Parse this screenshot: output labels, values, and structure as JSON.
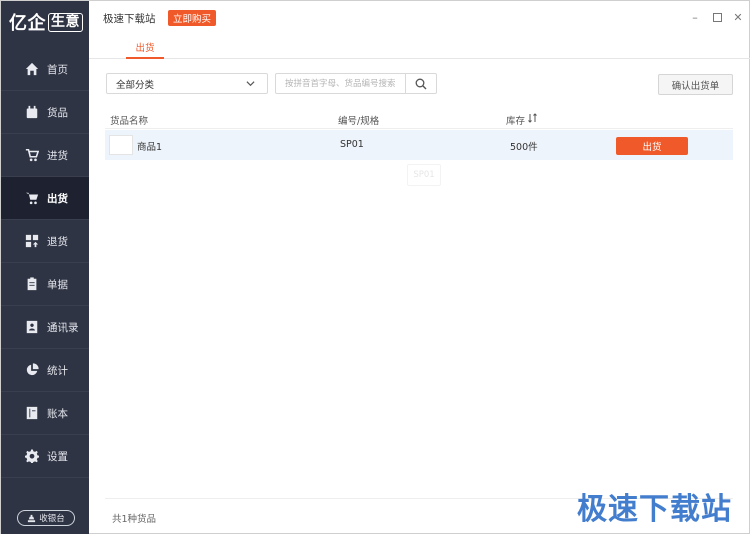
{
  "sidebar": {
    "logo_main": "亿企",
    "logo_box": "生意",
    "items": [
      {
        "label": "首页",
        "icon": "home-icon"
      },
      {
        "label": "货品",
        "icon": "box-icon"
      },
      {
        "label": "进货",
        "icon": "cart-in-icon"
      },
      {
        "label": "出货",
        "icon": "cart-out-icon"
      },
      {
        "label": "退货",
        "icon": "return-icon"
      },
      {
        "label": "单据",
        "icon": "clipboard-icon"
      },
      {
        "label": "通讯录",
        "icon": "contacts-icon"
      },
      {
        "label": "统计",
        "icon": "pie-chart-icon"
      },
      {
        "label": "账本",
        "icon": "ledger-icon"
      },
      {
        "label": "设置",
        "icon": "gear-icon"
      }
    ],
    "active_index": 3,
    "cashier_label": "收银台"
  },
  "titlebar": {
    "title": "极速下载站",
    "buy_label": "立即购买"
  },
  "tabs": [
    {
      "label": "出货"
    }
  ],
  "filters": {
    "category_value": "全部分类",
    "search_placeholder": "按拼音首字母、货品编号搜索"
  },
  "toolbar": {
    "confirm_label": "确认出货单"
  },
  "table": {
    "headers": {
      "name": "货品名称",
      "code": "编号/规格",
      "stock": "库存"
    },
    "rows": [
      {
        "name": "商品1",
        "code": "SP01",
        "stock": "500件",
        "action": "出货"
      }
    ],
    "ghost_code": "SP01"
  },
  "footer": {
    "summary": "共1种货品"
  },
  "watermark": "极速下载站",
  "colors": {
    "accent": "#f05a2a",
    "sidebar_bg": "#2f3444",
    "sidebar_active": "#1d2130"
  }
}
